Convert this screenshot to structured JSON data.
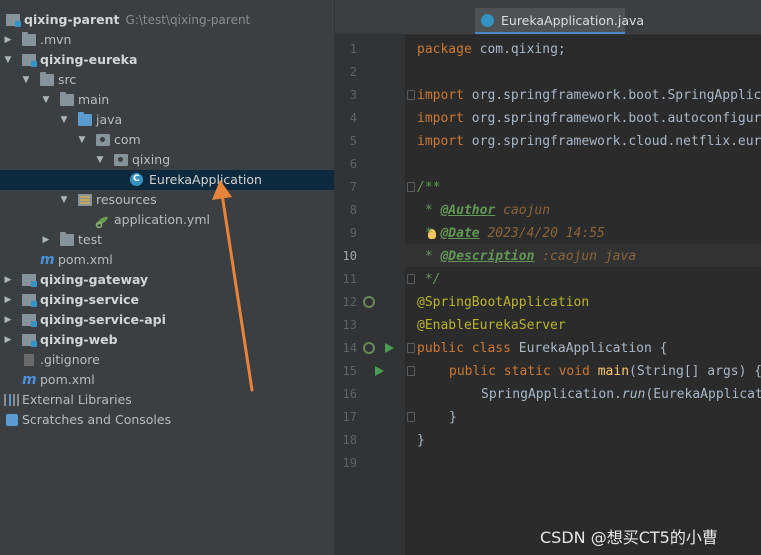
{
  "project_tree": {
    "root": {
      "name": "qixing-parent",
      "path": "G:\\test\\qixing-parent"
    },
    "items": [
      {
        "label": ".mvn"
      },
      {
        "label": "qixing-eureka"
      },
      {
        "label": "src"
      },
      {
        "label": "main"
      },
      {
        "label": "java"
      },
      {
        "label": "com"
      },
      {
        "label": "qixing"
      },
      {
        "label": "EurekaApplication"
      },
      {
        "label": "resources"
      },
      {
        "label": "application.yml"
      },
      {
        "label": "test"
      },
      {
        "label": "pom.xml"
      },
      {
        "label": "qixing-gateway"
      },
      {
        "label": "qixing-service"
      },
      {
        "label": "qixing-service-api"
      },
      {
        "label": "qixing-web"
      },
      {
        "label": ".gitignore"
      },
      {
        "label": "pom.xml"
      },
      {
        "label": "External Libraries"
      },
      {
        "label": "Scratches and Consoles"
      }
    ]
  },
  "editor": {
    "active_tab": "EurekaApplication.java",
    "current_line": "10",
    "line_numbers": [
      "1",
      "2",
      "3",
      "4",
      "5",
      "6",
      "7",
      "8",
      "9",
      "10",
      "11",
      "12",
      "13",
      "14",
      "15",
      "16",
      "17",
      "18",
      "19"
    ],
    "code": {
      "l1_kw": "package",
      "l1_rest": " com.qixing;",
      "l3_kw": "import",
      "l3_rest": " org.springframework.boot.SpringApplication;",
      "l4_kw": "import",
      "l4_rest": " org.springframework.boot.autoconfigure.SpringBootApplication;",
      "l5_kw": "import",
      "l5_rest": " org.springframework.cloud.netflix.eureka.server.EnableEurekaServer;",
      "l7": "/**",
      "l8_star": " * ",
      "l8_tag": "@Author",
      "l8_val": " caojun",
      "l9_star": " * ",
      "l9_tag": "@Date",
      "l9_val": " 2023/4/20 14:55",
      "l10_star": " * ",
      "l10_tag": "@Description",
      "l10_val": " :caojun java",
      "l11": " */",
      "l12": "@SpringBootApplication",
      "l13": "@EnableEurekaServer",
      "l14_kw": "public class",
      "l14_rest": " EurekaApplication {",
      "l15_kw": "public static void",
      "l15_fn": " main",
      "l15_rest": "(String[] args) {",
      "l16_pre": "SpringApplication.",
      "l16_call": "run",
      "l16_rest": "(EurekaApplication.class, args);",
      "l17": "}",
      "l18": "}"
    }
  },
  "watermark": "CSDN @想买CT5的小曹",
  "colors": {
    "selection": "#0d293e",
    "arrow": "#e8843a",
    "accent": "#4a88c7"
  }
}
